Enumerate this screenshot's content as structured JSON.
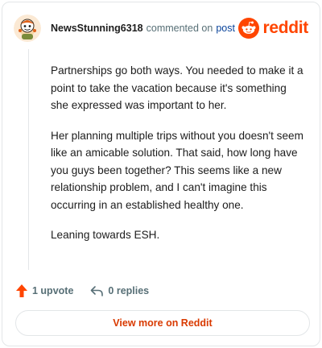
{
  "comment": {
    "username": "NewsStunning6318",
    "action_text": "commented on",
    "link_text": "post",
    "paragraphs": [
      "Partnerships go both ways. You needed to make it a point to take the vacation because it's something she expressed was important to her.",
      "Her planning multiple trips without you doesn't seem like an amicable solution. That said, how long have you guys been together? This seems like a new relationship problem, and I can't imagine this occurring in an established healthy one.",
      "Leaning towards ESH."
    ]
  },
  "brand": {
    "wordmark": "reddit",
    "icon": "reddit-logo-icon",
    "color": "#ff4500"
  },
  "actions": {
    "upvote_label": "1 upvote",
    "upvote_icon": "upvote-arrow-icon",
    "upvote_color": "#ff4500",
    "replies_label": "0 replies",
    "replies_icon": "reply-arrow-icon"
  },
  "footer": {
    "view_more_label": "View more on Reddit",
    "view_more_color": "#d93a00"
  },
  "avatar": {
    "icon": "user-avatar-icon"
  }
}
